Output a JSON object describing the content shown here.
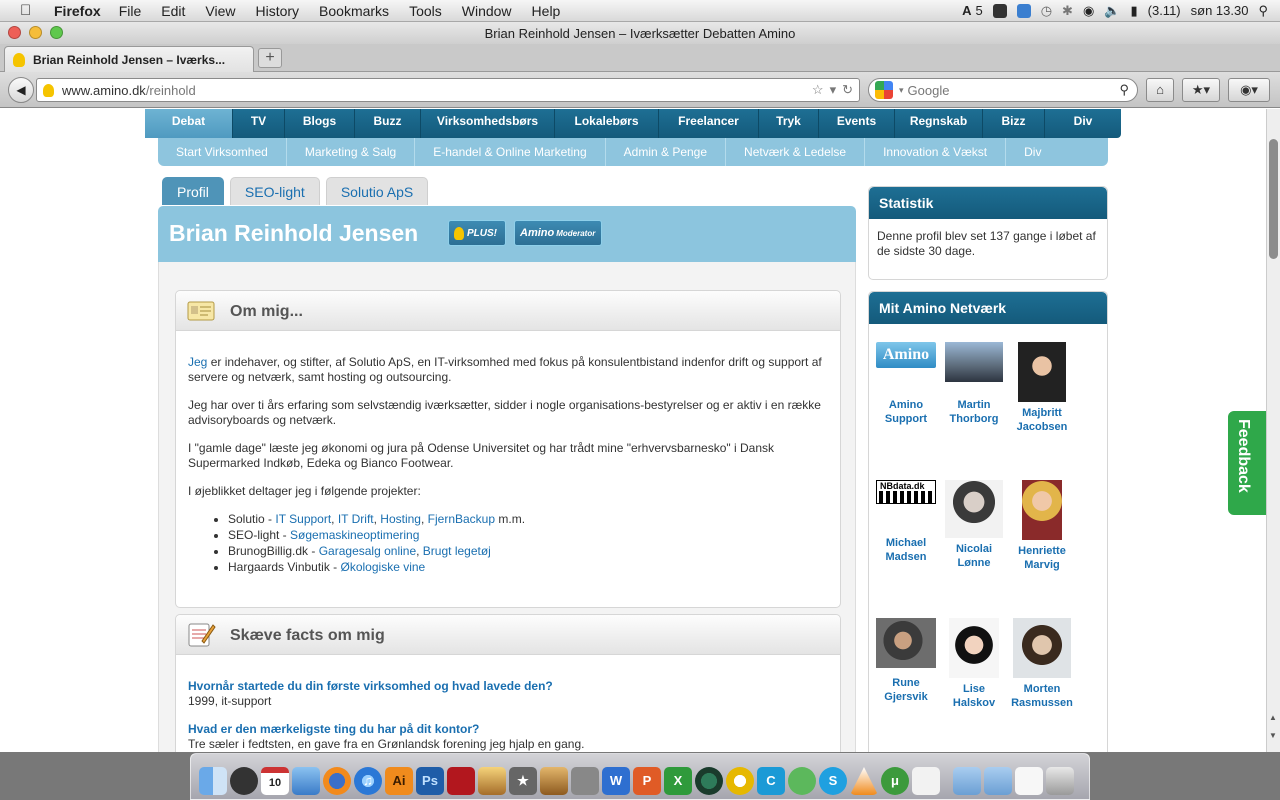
{
  "menubar": {
    "app": "Firefox",
    "items": [
      "File",
      "Edit",
      "View",
      "History",
      "Bookmarks",
      "Tools",
      "Window",
      "Help"
    ],
    "adobe_count": "5",
    "battery": "(3.11)",
    "clock": "søn 13.30"
  },
  "window": {
    "title": "Brian Reinhold Jensen – Iværksætter Debatten Amino"
  },
  "tab": {
    "label": "Brian Reinhold Jensen – Iværks...",
    "new_tab": "+"
  },
  "address": {
    "host": "www.amino.dk",
    "path": "/reinhold",
    "search_placeholder": "Google"
  },
  "main_nav": [
    "Debat",
    "TV",
    "Blogs",
    "Buzz",
    "Virksomhedsbørs",
    "Lokalebørs",
    "Freelancer",
    "Tryk",
    "Events",
    "Regnskab",
    "Bizz",
    "Div"
  ],
  "sub_nav": [
    "Start Virksomhed",
    "Marketing & Salg",
    "E-handel & Online Marketing",
    "Admin & Penge",
    "Netværk & Ledelse",
    "Innovation & Vækst",
    "Div"
  ],
  "profile_tabs": [
    "Profil",
    "SEO-light",
    "Solutio ApS"
  ],
  "profile": {
    "name": "Brian Reinhold Jensen",
    "plus_badge": "PLUS!",
    "moderator_badge": "Moderator",
    "moderator_logo": "Amino"
  },
  "about": {
    "title": "Om mig...",
    "p1_link": "Jeg",
    "p1": " er indehaver, og stifter, af Solutio ApS, en IT-virksomhed med fokus på konsulentbistand indenfor drift og support af servere og netværk, samt hosting og outsourcing.",
    "p2": "Jeg har over ti års erfaring som selvstændig iværksætter, sidder i nogle organisations-bestyrelser og er aktiv i en række advisoryboards og netværk.",
    "p3": "I \"gamle dage\" læste jeg økonomi og jura på Odense Universitet og har trådt mine \"erhvervsbarnesko\" i Dansk Supermarked Indkøb, Edeka og Bianco Footwear.",
    "p4": "I øjeblikket deltager jeg i følgende projekter:",
    "projects": [
      {
        "prefix": "Solutio - ",
        "links": [
          "IT Support",
          "IT Drift",
          "Hosting",
          "FjernBackup"
        ],
        "suffix": " m.m."
      },
      {
        "prefix": "SEO-light - ",
        "links": [
          "Søgemaskineoptimering"
        ],
        "suffix": ""
      },
      {
        "prefix": "BrunogBillig.dk - ",
        "links": [
          "Garagesalg online",
          "Brugt legetøj"
        ],
        "suffix": ""
      },
      {
        "prefix": "Hargaards Vinbutik - ",
        "links": [
          "Økologiske vine"
        ],
        "suffix": ""
      }
    ]
  },
  "facts": {
    "title": "Skæve facts om mig",
    "items": [
      {
        "q": "Hvornår startede du din første virksomhed og hvad lavede den?",
        "a": "1999, it-support"
      },
      {
        "q": "Hvad er den mærkeligste ting du har på dit kontor?",
        "a": "Tre sæler i fedtsten, en gave fra en Grønlandsk forening jeg hjalp en gang."
      }
    ]
  },
  "stats": {
    "title": "Statistik",
    "text": "Denne profil blev set 137 gange i løbet af de sidste 30 dage."
  },
  "network": {
    "title": "Mit Amino Netværk",
    "amino_logo": "Amino",
    "nbdata_logo": "NBdata.dk",
    "members": [
      {
        "first": "Amino",
        "last": "Support",
        "avatar": "amino-logo"
      },
      {
        "first": "Martin",
        "last": "Thorborg",
        "avatar": "photo"
      },
      {
        "first": "Majbritt",
        "last": "Jacobsen",
        "avatar": "photo"
      },
      {
        "first": "Michael",
        "last": "Madsen",
        "avatar": "nbdata-logo"
      },
      {
        "first": "Nicolai",
        "last": "Lønne",
        "avatar": "photo"
      },
      {
        "first": "Henriette",
        "last": "Marvig",
        "avatar": "photo"
      },
      {
        "first": "Rune",
        "last": "Gjersvik",
        "avatar": "photo"
      },
      {
        "first": "Lise",
        "last": "Halskov",
        "avatar": "photo"
      },
      {
        "first": "Morten",
        "last": "Rasmussen",
        "avatar": "photo"
      }
    ]
  },
  "feedback": {
    "label": "Feedback"
  },
  "dock": {
    "calendar_day": "10",
    "apps": [
      "finder",
      "dashboard",
      "ical",
      "preview",
      "firefox",
      "itunes",
      "illustrator",
      "photoshop",
      "flash",
      "iphoto",
      "imovie",
      "garageband",
      "vmware",
      "word",
      "powerpoint",
      "excel",
      "time-machine",
      "opera",
      "skype",
      "adium",
      "vlc",
      "utorrent",
      "textedit",
      "folder",
      "documents",
      "file",
      "trash"
    ]
  },
  "colors": {
    "nav_blue": "#145a7b",
    "subnav_blue": "#8ec5de",
    "link_blue": "#1a6fb0",
    "feedback_green": "#2fa84a"
  }
}
